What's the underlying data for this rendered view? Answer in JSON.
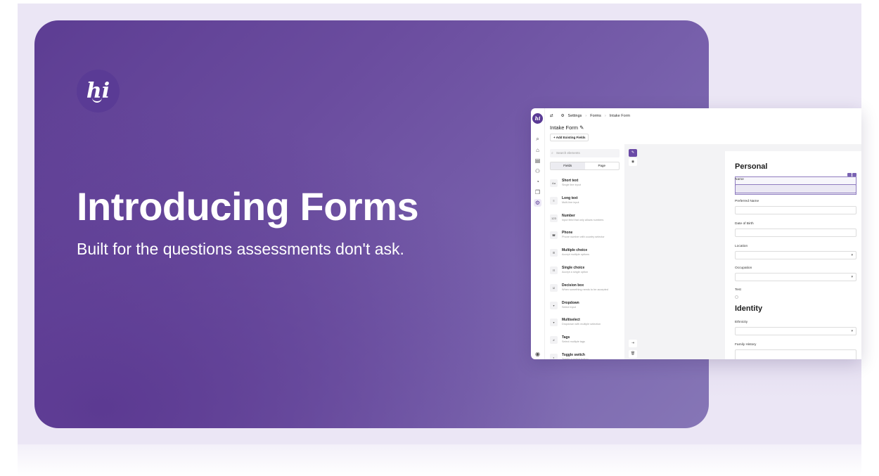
{
  "hero": {
    "logo_text": "hi",
    "title": "Introducing Forms",
    "subtitle": "Built for the questions assessments don't ask."
  },
  "app": {
    "logo_text": "hi",
    "breadcrumb": [
      "Settings",
      "Forms",
      "Intake Form"
    ],
    "form_title": "Intake Form",
    "add_button": "+ Add Existing Fields",
    "search_placeholder": "Search elements",
    "tabs": [
      "Fields",
      "Page"
    ],
    "elements": [
      {
        "icon": "Aa",
        "title": "Short text",
        "desc": "Single line input"
      },
      {
        "icon": "≡",
        "title": "Long text",
        "desc": "Multi-line input"
      },
      {
        "icon": "123",
        "title": "Number",
        "desc": "Input field that only allows numbers"
      },
      {
        "icon": "☎",
        "title": "Phone",
        "desc": "Phone number with country selector"
      },
      {
        "icon": "☰",
        "title": "Multiple choice",
        "desc": "Accept multiple options"
      },
      {
        "icon": "☷",
        "title": "Single choice",
        "desc": "Accept a single option"
      },
      {
        "icon": "☑",
        "title": "Decision box",
        "desc": "When something needs to be accepted"
      },
      {
        "icon": "▾",
        "title": "Dropdown",
        "desc": "Select input"
      },
      {
        "icon": "▾",
        "title": "Multiselect",
        "desc": "Dropdown with multiple selection"
      },
      {
        "icon": "#",
        "title": "Tags",
        "desc": "Select multiple tags"
      },
      {
        "icon": "◐",
        "title": "Toggle switch",
        "desc": "Toggle a switch button"
      }
    ],
    "form": {
      "section1": "Personal",
      "fields1": [
        "Name",
        "Preferred Name",
        "Date of Birth",
        "Location",
        "Occupation",
        "Test"
      ],
      "section2": "Identity",
      "fields2": [
        "Ethnicity",
        "Family History"
      ]
    }
  }
}
